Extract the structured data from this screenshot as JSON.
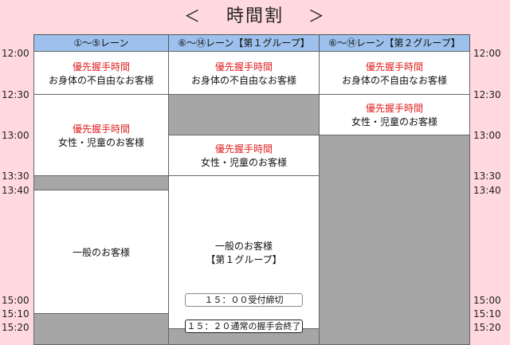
{
  "title": {
    "left_arrow": "＜",
    "text": "時間割",
    "right_arrow": "＞"
  },
  "headers": [
    "①〜⑤レーン",
    "⑥〜⑭レーン【第１グループ】",
    "⑥〜⑭レーン【第２グループ】"
  ],
  "times": [
    "12:00",
    "12:30",
    "13:00",
    "13:30",
    "13:40",
    "15:00",
    "15:10",
    "15:20"
  ],
  "col1": {
    "priority1": {
      "red": "優先握手時間",
      "text": "お身体の不自由なお客様"
    },
    "priority2": {
      "red": "優先握手時間",
      "text": "女性・児童のお客様"
    },
    "general": {
      "text": "一般のお客様"
    }
  },
  "col2": {
    "priority1": {
      "red": "優先握手時間",
      "text": "お身体の不自由なお客様"
    },
    "priority2": {
      "red": "優先握手時間",
      "text": "女性・児童のお客様"
    },
    "general": {
      "line1": "一般のお客様",
      "line2": "【第１グループ】"
    }
  },
  "col3": {
    "priority1": {
      "red": "優先握手時間",
      "text": "お身体の不自由なお客様"
    },
    "priority2": {
      "red": "優先握手時間",
      "text": "女性・児童のお客様"
    }
  },
  "notes": {
    "reception_close": "１５：００受付締切",
    "end": "１５：２０通常の握手会終了"
  },
  "colors": {
    "background": "#ffd9de",
    "header": "#9dc1ec",
    "closed": "#a6a6a6",
    "priority_text": "#e02020"
  }
}
